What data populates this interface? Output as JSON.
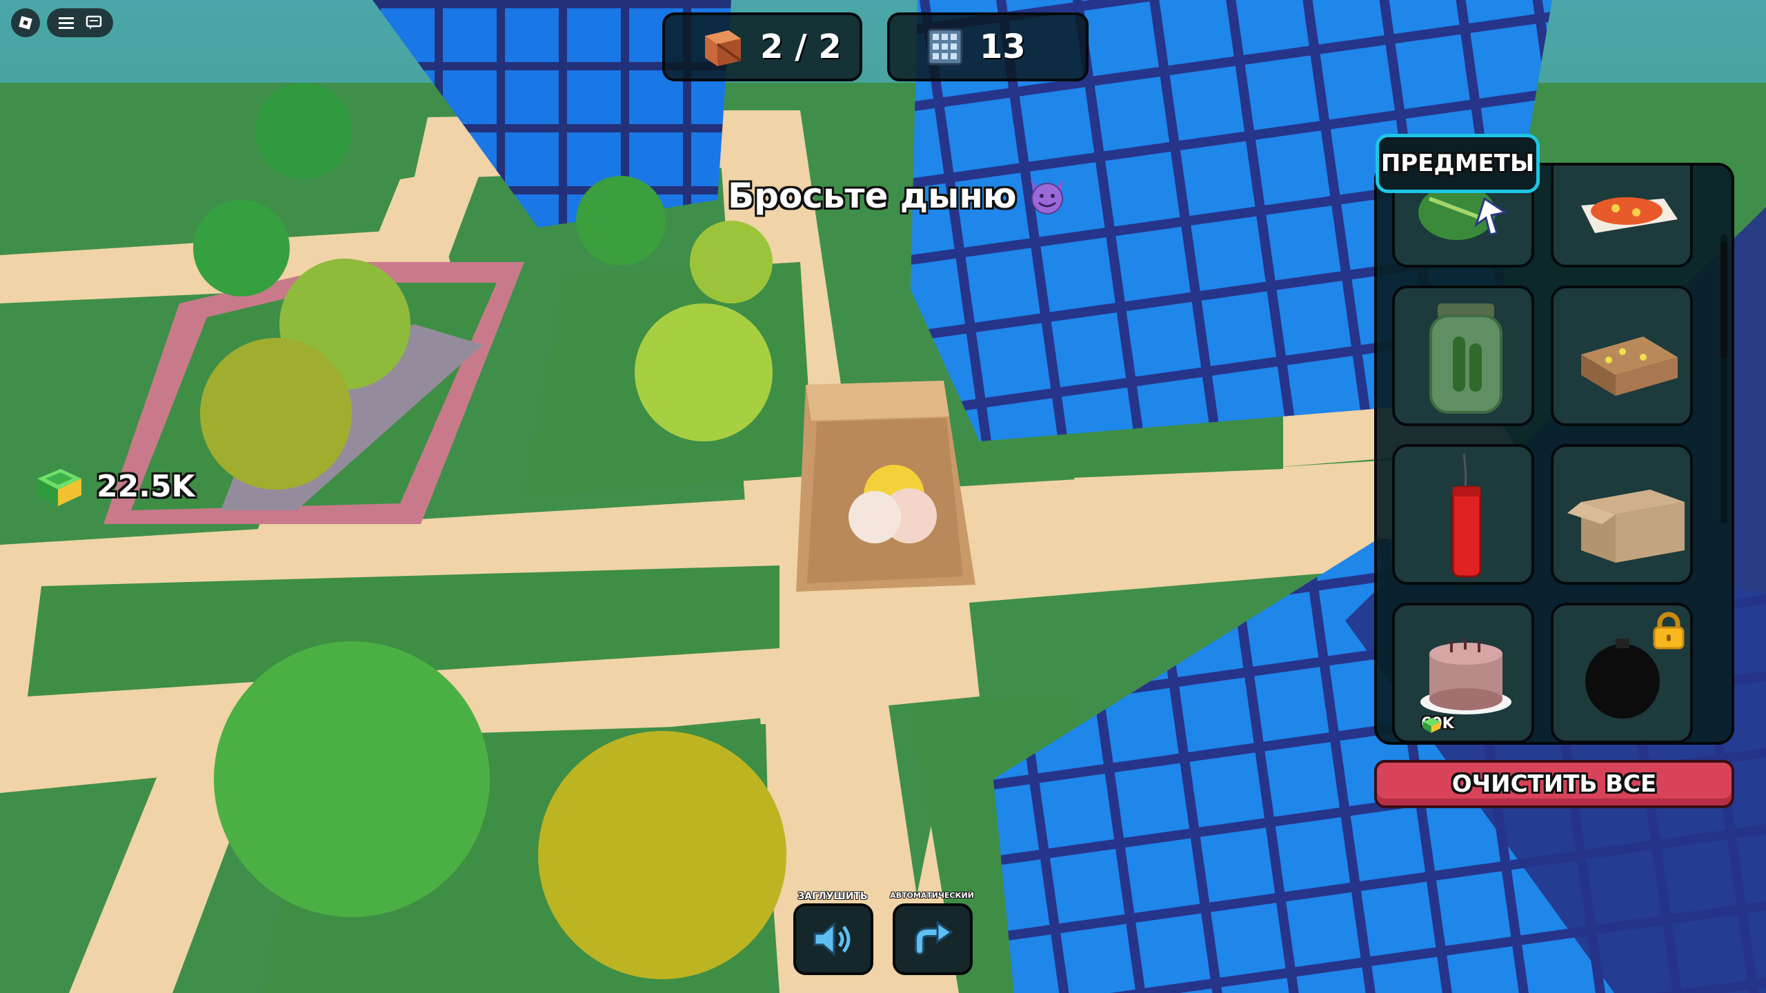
{
  "hud": {
    "boxes_counter": "2 / 2",
    "blocks_counter": "13",
    "hint_text": "Бросьте дыню",
    "money": "22.5K"
  },
  "inventory": {
    "tab_label": "ПРЕДМЕТЫ",
    "items": [
      {
        "name": "watermelon",
        "selected": true
      },
      {
        "name": "pizza"
      },
      {
        "name": "pickle-jar"
      },
      {
        "name": "cake-slab"
      },
      {
        "name": "dynamite"
      },
      {
        "name": "cardboard-box"
      },
      {
        "name": "cake",
        "price": "60K"
      },
      {
        "name": "bomb",
        "locked": true
      }
    ],
    "clear_all_label": "ОЧИСТИТЬ ВСЕ"
  },
  "controls": {
    "mute_label": "ЗАГЛУШИТЬ",
    "auto_label": "АВТОМАТИЧЕСКИЙ"
  },
  "colors": {
    "grass": "#3f8f4a",
    "path": "#f0d3a6",
    "building_glass": "#1a77e6",
    "building_frame": "#23317a",
    "panel_tab_border": "#1fc6e6",
    "clear_button": "#d8435a"
  }
}
